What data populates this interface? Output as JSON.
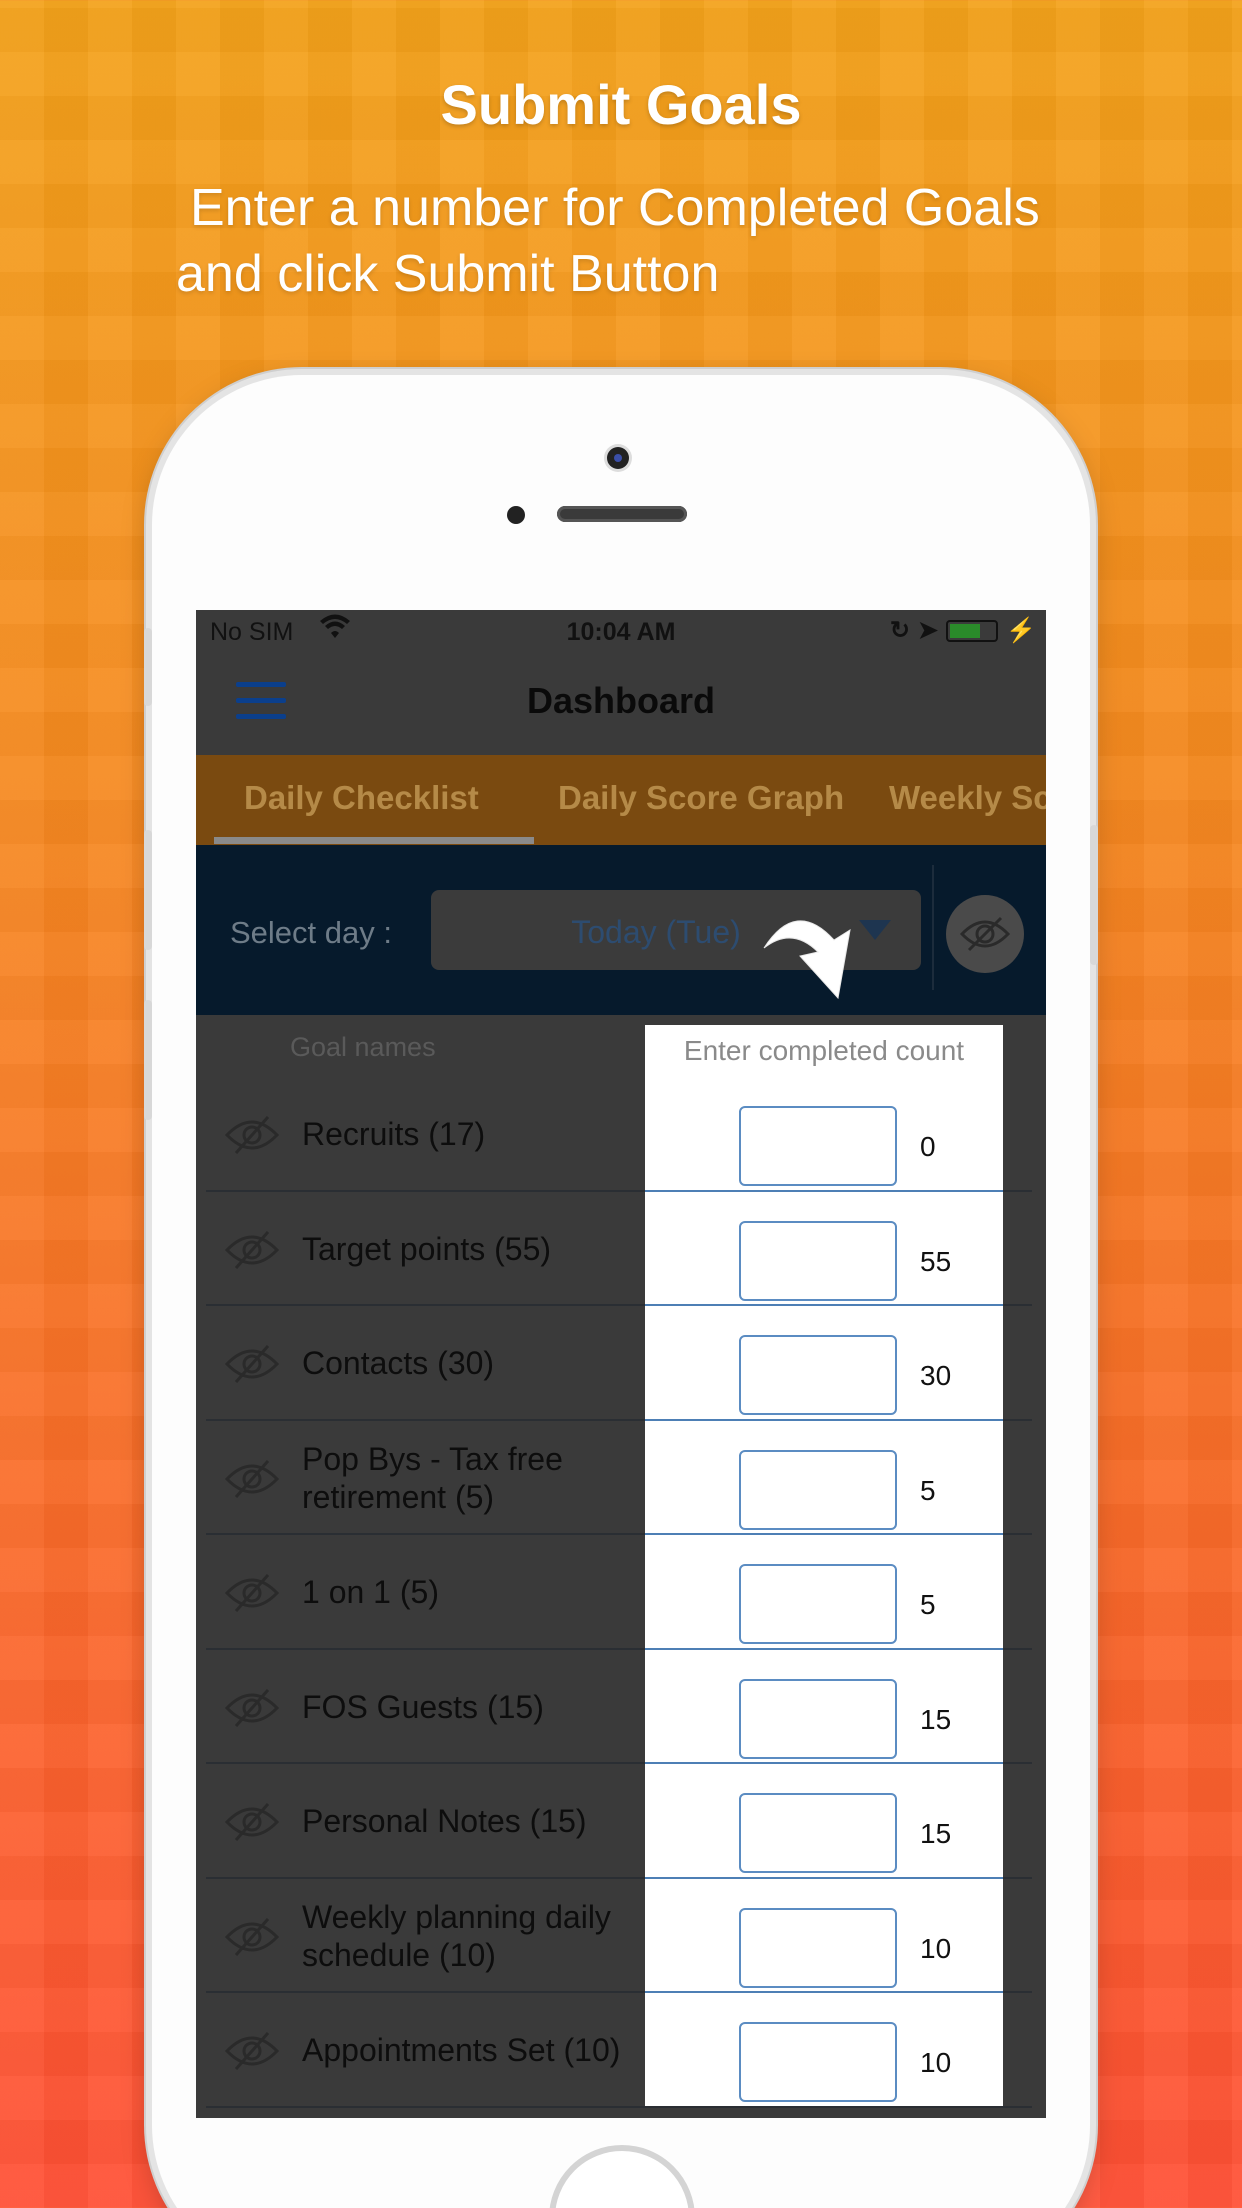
{
  "promo": {
    "headline": "Submit Goals",
    "subline_1": "Enter a number for Completed Goals",
    "subline_2": "and click Submit Button"
  },
  "status_bar": {
    "carrier": "No SIM",
    "time": "10:04 AM"
  },
  "nav": {
    "title": "Dashboard"
  },
  "tabs": [
    {
      "label": "Daily Checklist"
    },
    {
      "label": "Daily Score Graph"
    },
    {
      "label": "Weekly Sc"
    }
  ],
  "day_selector": {
    "label": "Select day :",
    "value": "Today (Tue)"
  },
  "columns": {
    "goal_names": "Goal names",
    "completed": "Enter completed count"
  },
  "goals": [
    {
      "label": "Recruits (17)",
      "target": "0"
    },
    {
      "label": "Target points (55)",
      "target": "55"
    },
    {
      "label": "Contacts (30)",
      "target": "30"
    },
    {
      "label": "Pop Bys - Tax free retirement (5)",
      "target": "5"
    },
    {
      "label": "1 on 1 (5)",
      "target": "5"
    },
    {
      "label": "FOS Guests (15)",
      "target": "15"
    },
    {
      "label": "Personal Notes (15)",
      "target": "15"
    },
    {
      "label": "Weekly planning daily schedule (10)",
      "target": "10"
    },
    {
      "label": "Appointments Set (10)",
      "target": "10"
    }
  ],
  "colors": {
    "accent_blue": "#0b3f8c",
    "input_border": "#5b8cc2",
    "tab_bar": "#7a4a10",
    "select_bar": "#061a2c"
  }
}
